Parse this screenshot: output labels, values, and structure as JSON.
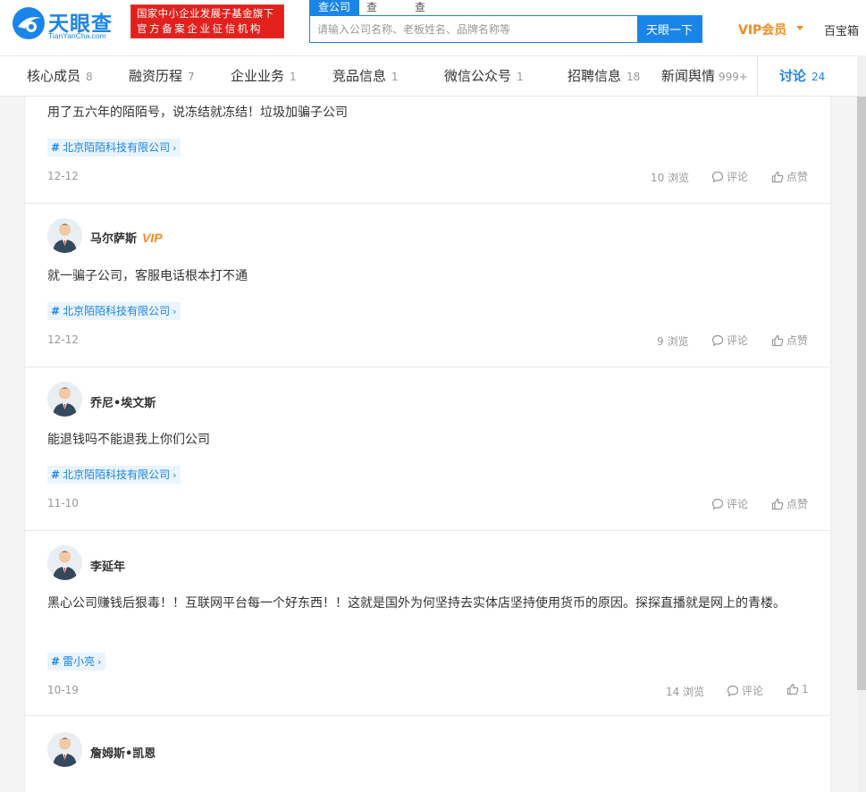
{
  "brand": {
    "name": "天眼查",
    "domain": "TianYanCha.com",
    "color": "#1a85e8"
  },
  "slogan": {
    "line1": "国家中小企业发展子基金旗下",
    "line2": "官方备案企业征信机构"
  },
  "search": {
    "tabs": [
      {
        "label": "查公司",
        "active": true
      },
      {
        "label": "查老板",
        "active": false
      },
      {
        "label": "查关系",
        "active": false
      }
    ],
    "placeholder": "请输入公司名称、老板姓名、品牌名称等",
    "button": "天眼一下"
  },
  "header_links": {
    "vip": "VIP会员",
    "treasure": "百宝箱"
  },
  "nav": [
    {
      "label": "核心成员",
      "count": "8"
    },
    {
      "label": "融资历程",
      "count": "7"
    },
    {
      "label": "企业业务",
      "count": "1"
    },
    {
      "label": "竞品信息",
      "count": "1"
    },
    {
      "label": "微信公众号",
      "count": "1"
    },
    {
      "label": "招聘信息",
      "count": "18"
    },
    {
      "label": "新闻舆情",
      "count": "999+"
    },
    {
      "label": "讨论",
      "count": "24",
      "active": true
    }
  ],
  "posts": [
    {
      "text": "用了五六年的陌陌号，说冻结就冻结！垃圾加骗子公司",
      "tag": "北京陌陌科技有限公司",
      "date": "12-12",
      "views": "10 浏览",
      "comment": "评论",
      "like": "点赞"
    },
    {
      "user": "马尔萨斯",
      "vip": "VIP",
      "text": "就一骗子公司，客服电话根本打不通",
      "tag": "北京陌陌科技有限公司",
      "date": "12-12",
      "views": "9 浏览",
      "comment": "评论",
      "like": "点赞"
    },
    {
      "user": "乔尼•埃文斯",
      "text": "能退钱吗不能退我上你们公司",
      "tag": "北京陌陌科技有限公司",
      "date": "11-10",
      "comment": "评论",
      "like": "点赞"
    },
    {
      "user": "李延年",
      "text": "黑心公司赚钱后狠毒！！互联网平台每一个好东西！！这就是国外为何坚持去实体店坚持使用货币的原因。探探直播就是网上的青楼。",
      "tag": "雷小亮",
      "date": "10-19",
      "views": "14 浏览",
      "comment": "评论",
      "like": "1"
    },
    {
      "user": "詹姆斯•凯恩"
    }
  ],
  "colors": {
    "accent": "#1a85e8",
    "vip": "#f7891e",
    "slogan_bg": "#e2211c",
    "tag_bg": "#eaf4fd"
  },
  "icons": [
    "logo-eye-icon",
    "comment-icon",
    "like-icon",
    "avatar-icon",
    "hash-icon",
    "chevron-right-icon"
  ]
}
